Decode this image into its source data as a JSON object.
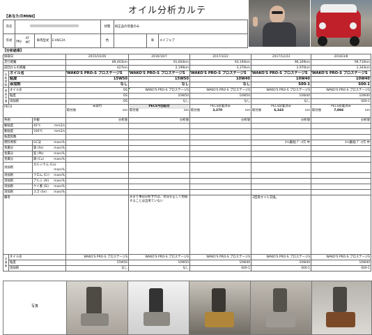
{
  "title": "オイル分析カルテ",
  "owner_header": "【あなたのMINI】",
  "info": {
    "name_label": "氏名",
    "name_value": "",
    "use_label": "状態",
    "use_value": "純正品の装着のみ",
    "model_label": "年式",
    "year": "98y",
    "at_label": "AT",
    "mt_label": "MT",
    "engine_label": "車両型式",
    "engine_value": "E-XN12A",
    "color_label": "色",
    "plate_label": "車",
    "note": "メイフェア"
  },
  "section_result": "【分析結果】",
  "dates": [
    "2015/10/26",
    "2016/10/7",
    "2017/3/22",
    "2017/12/23",
    "2018/3/8"
  ],
  "odometer": [
    "89,403km",
    "91,604km",
    "93,194km",
    "96,169km",
    "99,710km"
  ],
  "distance": [
    "427km",
    "2,199km",
    "3,370km",
    "2,970km",
    "1,343km"
  ],
  "rows_top": [
    {
      "label": "走行距離"
    },
    {
      "label": "前回からの距離"
    }
  ],
  "oil_label": "オイル名",
  "oil_name": "WAKO'S PRO-S プロステージS",
  "visc_label": "粘度",
  "visc": [
    "15W50",
    "15W50",
    "10W40",
    "10W40",
    "10W40"
  ],
  "add_label": "添加剤",
  "add": [
    "なし",
    "なし",
    "なし",
    "S00-1",
    "S00-1"
  ],
  "prev_oil_rows": [
    "オイル名",
    "粘度",
    "添加剤"
  ],
  "prev_oil": [
    "WAKO'S PRO-S プロステージS",
    "WAKO'S PRO-S プロステージS",
    "WAKO'S PRO-S プロステージS",
    "WAKO'S PRO-S プロステージS",
    "WAKO'S PRO-S プロステージS"
  ],
  "prev_visc": [
    "OS",
    "10W50",
    "10W50",
    "10W40",
    "10W40"
  ],
  "prev_add": [
    "OS",
    "なし",
    "なし",
    "なし",
    "S00-1"
  ],
  "pecs_label": "PECS",
  "pecs": [
    {
      "head": "未取付",
      "sub": "取付後",
      "val": "",
      "unit": "km"
    },
    {
      "head": "PECS今回取付",
      "sub": "取付後",
      "val": "",
      "unit": "km"
    },
    {
      "head": "PECS装着済み",
      "sub": "取付後",
      "val": "3,370",
      "unit": "km"
    },
    {
      "head": "PECS装着済み",
      "sub": "取付後",
      "val": "6,343",
      "unit": "km"
    },
    {
      "head": "PECS装着済み",
      "sub": "取付後",
      "val": "7,894",
      "unit": "km"
    }
  ],
  "color_row": "色相",
  "appearance": "外観",
  "appearance_note": "分析値",
  "temp_rows": [
    {
      "label": "動粘度",
      "cond": "40℃",
      "unit": "mm2/s"
    },
    {
      "label": "動粘度",
      "cond": "100℃",
      "unit": "mm2/s"
    }
  ],
  "viscosity_index": "粘度指数",
  "metals": [
    {
      "a": "燃料希釈",
      "b": "GC法",
      "u": "mass%"
    },
    {
      "a": "金属分",
      "b": "鉄 (Fe)",
      "u": "mass%"
    },
    {
      "a": "金属分",
      "b": "鉛 (Pb)",
      "u": "mass%"
    },
    {
      "a": "金属分",
      "b": "銅 (Cu)",
      "u": "mass%"
    },
    {
      "a": "添加剤",
      "b": "カルシウム (Ca)",
      "u": "mass%"
    },
    {
      "a": "添加剤",
      "b": "クロム (Cr)",
      "u": "mass%"
    },
    {
      "a": "添加剤",
      "b": "アルミ (Al)",
      "u": "mass%"
    },
    {
      "a": "添加剤",
      "b": "ケイ素 (Si)",
      "u": "mass%"
    },
    {
      "a": "添加剤",
      "b": "スズ (Sn)",
      "u": "mass%"
    }
  ],
  "dilution_notes": [
    "",
    "",
    "",
    "ﾀｲﾑ動粘 ﾃﾞｰﾀ欠 中",
    "ﾀｲﾑ動粘 ﾃﾞｰﾀ欠 中"
  ],
  "remarks_label": "備考",
  "remarks": [
    "",
    "あまり事前分析すれば、状況を正しく把握することは出来ていない",
    "",
    "3回目オイル交換。",
    ""
  ],
  "after_label": "交換後",
  "after_rows": [
    "オイル名",
    "粘度",
    "添加剤"
  ],
  "after_oil": [
    "WAKO'S PRO-S プロステージS",
    "WAKO'S PRO-S プロステージS",
    "WAKO'S PRO-S プロステージS",
    "WAKO'S PRO-S プロステージS",
    "WAKO'S PRO-S プロステージS"
  ],
  "after_visc": [
    "15W50",
    "10W50",
    "10W40",
    "10W40",
    "10W40"
  ],
  "after_add": [
    "なし",
    "なし",
    "S00-1",
    "S00-1",
    "S00-1"
  ],
  "photo_label": "写真",
  "colors": {
    "accent": "#2a8a2a",
    "section": "#dfe7f1",
    "grid": "#666666",
    "car": "#c0202a"
  }
}
